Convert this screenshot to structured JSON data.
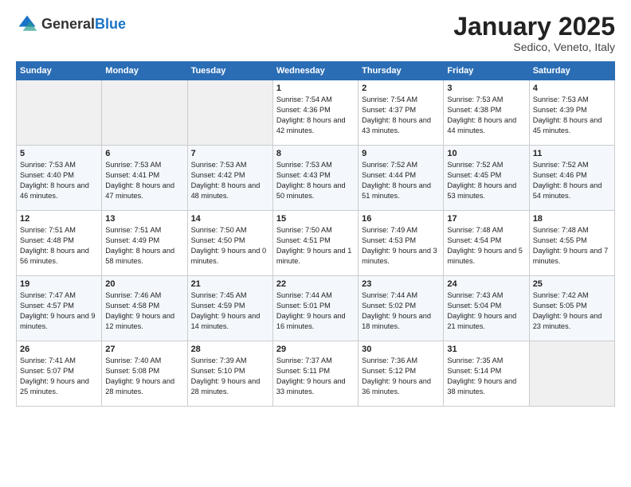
{
  "logo": {
    "general": "General",
    "blue": "Blue"
  },
  "header": {
    "month": "January 2025",
    "location": "Sedico, Veneto, Italy"
  },
  "weekdays": [
    "Sunday",
    "Monday",
    "Tuesday",
    "Wednesday",
    "Thursday",
    "Friday",
    "Saturday"
  ],
  "weeks": [
    [
      {
        "day": "",
        "data": ""
      },
      {
        "day": "",
        "data": ""
      },
      {
        "day": "",
        "data": ""
      },
      {
        "day": "1",
        "data": "Sunrise: 7:54 AM\nSunset: 4:36 PM\nDaylight: 8 hours and 42 minutes."
      },
      {
        "day": "2",
        "data": "Sunrise: 7:54 AM\nSunset: 4:37 PM\nDaylight: 8 hours and 43 minutes."
      },
      {
        "day": "3",
        "data": "Sunrise: 7:53 AM\nSunset: 4:38 PM\nDaylight: 8 hours and 44 minutes."
      },
      {
        "day": "4",
        "data": "Sunrise: 7:53 AM\nSunset: 4:39 PM\nDaylight: 8 hours and 45 minutes."
      }
    ],
    [
      {
        "day": "5",
        "data": "Sunrise: 7:53 AM\nSunset: 4:40 PM\nDaylight: 8 hours and 46 minutes."
      },
      {
        "day": "6",
        "data": "Sunrise: 7:53 AM\nSunset: 4:41 PM\nDaylight: 8 hours and 47 minutes."
      },
      {
        "day": "7",
        "data": "Sunrise: 7:53 AM\nSunset: 4:42 PM\nDaylight: 8 hours and 48 minutes."
      },
      {
        "day": "8",
        "data": "Sunrise: 7:53 AM\nSunset: 4:43 PM\nDaylight: 8 hours and 50 minutes."
      },
      {
        "day": "9",
        "data": "Sunrise: 7:52 AM\nSunset: 4:44 PM\nDaylight: 8 hours and 51 minutes."
      },
      {
        "day": "10",
        "data": "Sunrise: 7:52 AM\nSunset: 4:45 PM\nDaylight: 8 hours and 53 minutes."
      },
      {
        "day": "11",
        "data": "Sunrise: 7:52 AM\nSunset: 4:46 PM\nDaylight: 8 hours and 54 minutes."
      }
    ],
    [
      {
        "day": "12",
        "data": "Sunrise: 7:51 AM\nSunset: 4:48 PM\nDaylight: 8 hours and 56 minutes."
      },
      {
        "day": "13",
        "data": "Sunrise: 7:51 AM\nSunset: 4:49 PM\nDaylight: 8 hours and 58 minutes."
      },
      {
        "day": "14",
        "data": "Sunrise: 7:50 AM\nSunset: 4:50 PM\nDaylight: 9 hours and 0 minutes."
      },
      {
        "day": "15",
        "data": "Sunrise: 7:50 AM\nSunset: 4:51 PM\nDaylight: 9 hours and 1 minute."
      },
      {
        "day": "16",
        "data": "Sunrise: 7:49 AM\nSunset: 4:53 PM\nDaylight: 9 hours and 3 minutes."
      },
      {
        "day": "17",
        "data": "Sunrise: 7:48 AM\nSunset: 4:54 PM\nDaylight: 9 hours and 5 minutes."
      },
      {
        "day": "18",
        "data": "Sunrise: 7:48 AM\nSunset: 4:55 PM\nDaylight: 9 hours and 7 minutes."
      }
    ],
    [
      {
        "day": "19",
        "data": "Sunrise: 7:47 AM\nSunset: 4:57 PM\nDaylight: 9 hours and 9 minutes."
      },
      {
        "day": "20",
        "data": "Sunrise: 7:46 AM\nSunset: 4:58 PM\nDaylight: 9 hours and 12 minutes."
      },
      {
        "day": "21",
        "data": "Sunrise: 7:45 AM\nSunset: 4:59 PM\nDaylight: 9 hours and 14 minutes."
      },
      {
        "day": "22",
        "data": "Sunrise: 7:44 AM\nSunset: 5:01 PM\nDaylight: 9 hours and 16 minutes."
      },
      {
        "day": "23",
        "data": "Sunrise: 7:44 AM\nSunset: 5:02 PM\nDaylight: 9 hours and 18 minutes."
      },
      {
        "day": "24",
        "data": "Sunrise: 7:43 AM\nSunset: 5:04 PM\nDaylight: 9 hours and 21 minutes."
      },
      {
        "day": "25",
        "data": "Sunrise: 7:42 AM\nSunset: 5:05 PM\nDaylight: 9 hours and 23 minutes."
      }
    ],
    [
      {
        "day": "26",
        "data": "Sunrise: 7:41 AM\nSunset: 5:07 PM\nDaylight: 9 hours and 25 minutes."
      },
      {
        "day": "27",
        "data": "Sunrise: 7:40 AM\nSunset: 5:08 PM\nDaylight: 9 hours and 28 minutes."
      },
      {
        "day": "28",
        "data": "Sunrise: 7:39 AM\nSunset: 5:10 PM\nDaylight: 9 hours and 28 minutes."
      },
      {
        "day": "29",
        "data": "Sunrise: 7:37 AM\nSunset: 5:11 PM\nDaylight: 9 hours and 33 minutes."
      },
      {
        "day": "30",
        "data": "Sunrise: 7:36 AM\nSunset: 5:12 PM\nDaylight: 9 hours and 36 minutes."
      },
      {
        "day": "31",
        "data": "Sunrise: 7:35 AM\nSunset: 5:14 PM\nDaylight: 9 hours and 38 minutes."
      },
      {
        "day": "",
        "data": ""
      }
    ]
  ]
}
